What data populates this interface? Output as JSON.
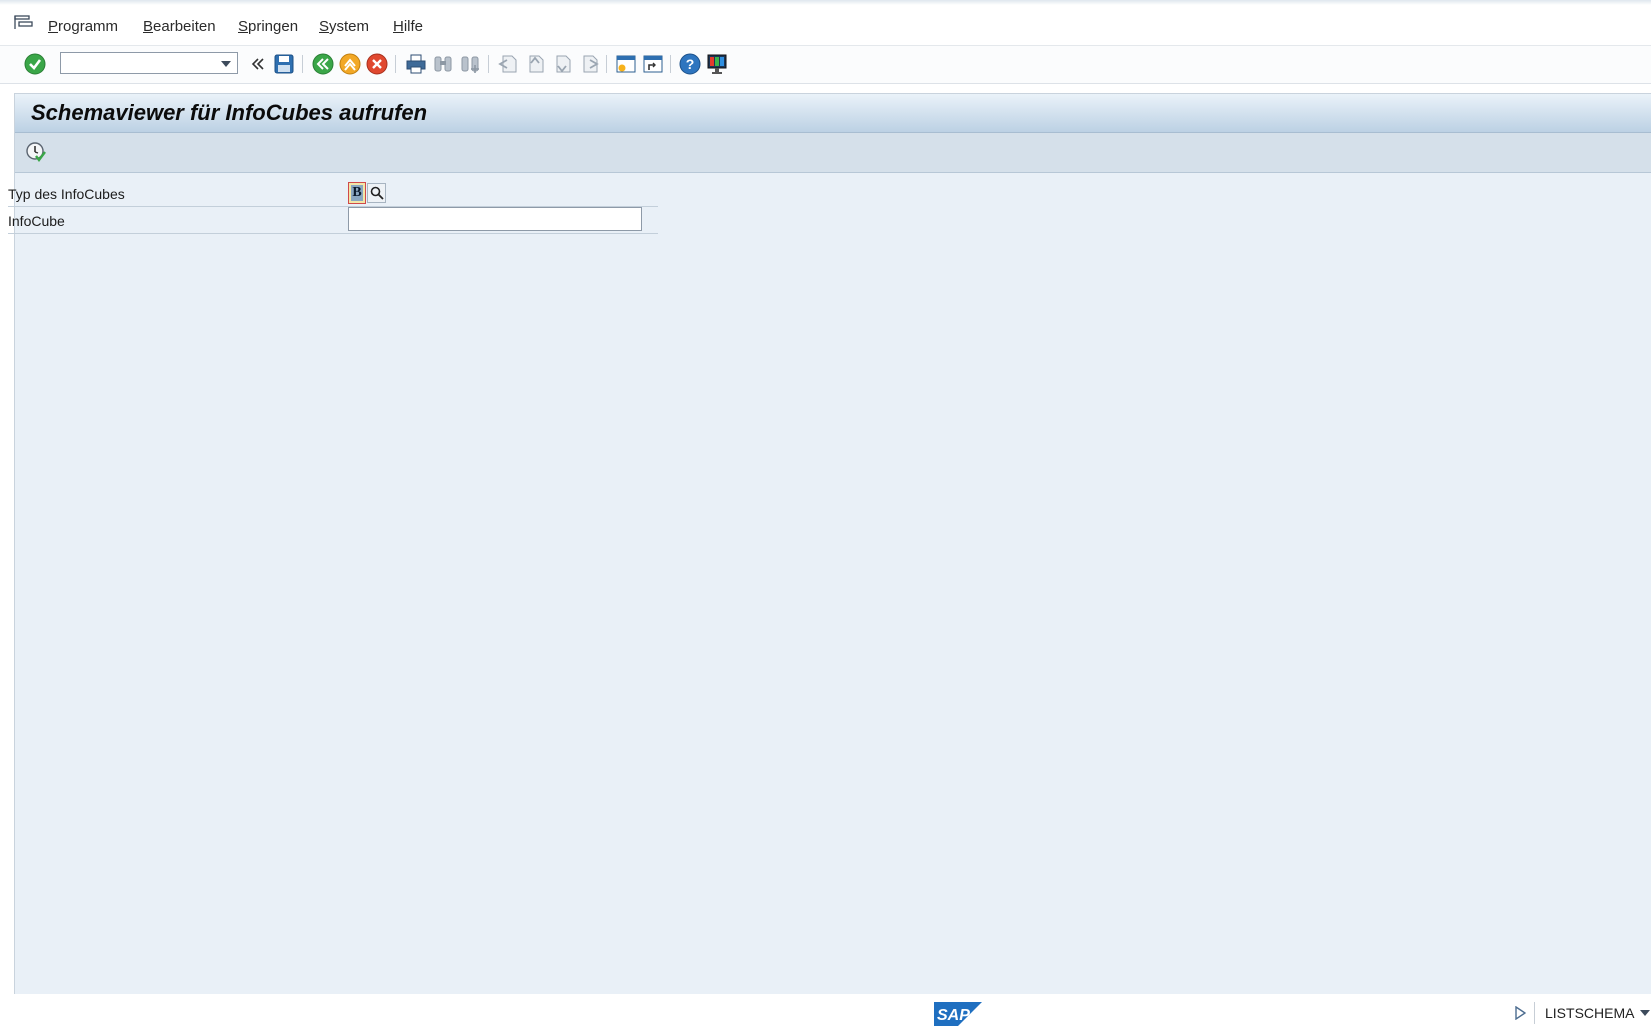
{
  "menubar": {
    "items": [
      {
        "mnemonic": "P",
        "rest": "rogramm"
      },
      {
        "mnemonic": "B",
        "rest": "earbeiten"
      },
      {
        "mnemonic": "S",
        "rest": "pringen"
      },
      {
        "mnemonic": "S",
        "rest": "ystem"
      },
      {
        "mnemonic": "H",
        "rest": "ilfe"
      }
    ]
  },
  "toolbar": {
    "command_field_value": "",
    "icons": [
      "enter-check-icon",
      "save-icon",
      "back-icon",
      "exit-icon",
      "cancel-icon",
      "print-icon",
      "find-icon",
      "find-next-icon",
      "first-page-icon",
      "previous-page-icon",
      "next-page-icon",
      "last-page-icon",
      "new-session-icon",
      "create-shortcut-icon",
      "help-icon",
      "customize-layout-icon"
    ]
  },
  "main": {
    "title": "Schemaviewer für InfoCubes aufrufen"
  },
  "form": {
    "type_label": "Typ des InfoCubes",
    "type_value": "B",
    "infocube_label": "InfoCube",
    "infocube_value": ""
  },
  "statusbar": {
    "logo_text": "SAP",
    "program": "LISTSCHEMA"
  },
  "colors": {
    "panel_bg": "#e9f0f7",
    "title_gradient_bottom": "#bcd1e4",
    "app_toolbar_bg": "#d5e0ea",
    "sap_blue": "#1f6fc0"
  }
}
